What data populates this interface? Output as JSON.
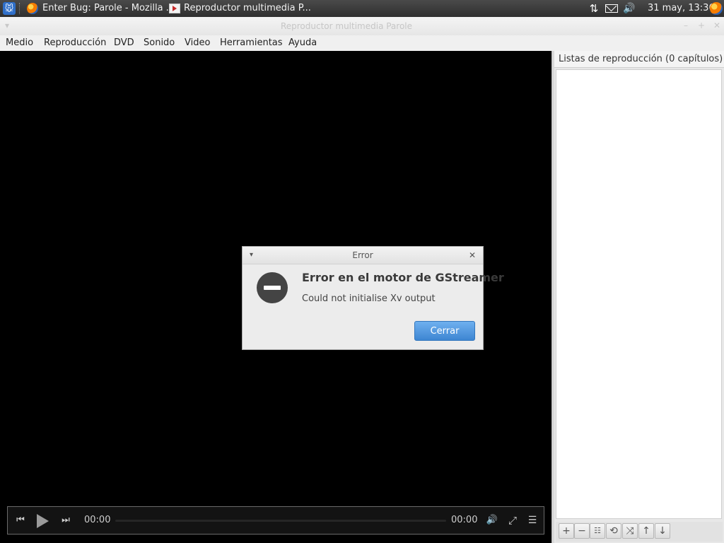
{
  "panel": {
    "tasks": [
      {
        "label": "Enter Bug: Parole - Mozilla ..."
      },
      {
        "label": "Reproductor multimedia P..."
      }
    ],
    "datetime": "31 may, 13:36"
  },
  "window": {
    "title": "Reproductor multimedia Parole",
    "menu": [
      "Medio",
      "Reproducción",
      "DVD",
      "Sonido",
      "Video",
      "Herramientas",
      "Ayuda"
    ]
  },
  "controls": {
    "elapsed": "00:00",
    "duration": "00:00",
    "progress_fraction": 0
  },
  "playlist": {
    "header": "Listas de reproducción (0 capítulos)"
  },
  "dialog": {
    "title": "Error",
    "heading": "Error en el motor de GStreamer",
    "message": "Could not initialise Xv output",
    "close_label": "Cerrar"
  },
  "colors": {
    "accent": "#4a90d9",
    "video_background": "#000000"
  }
}
